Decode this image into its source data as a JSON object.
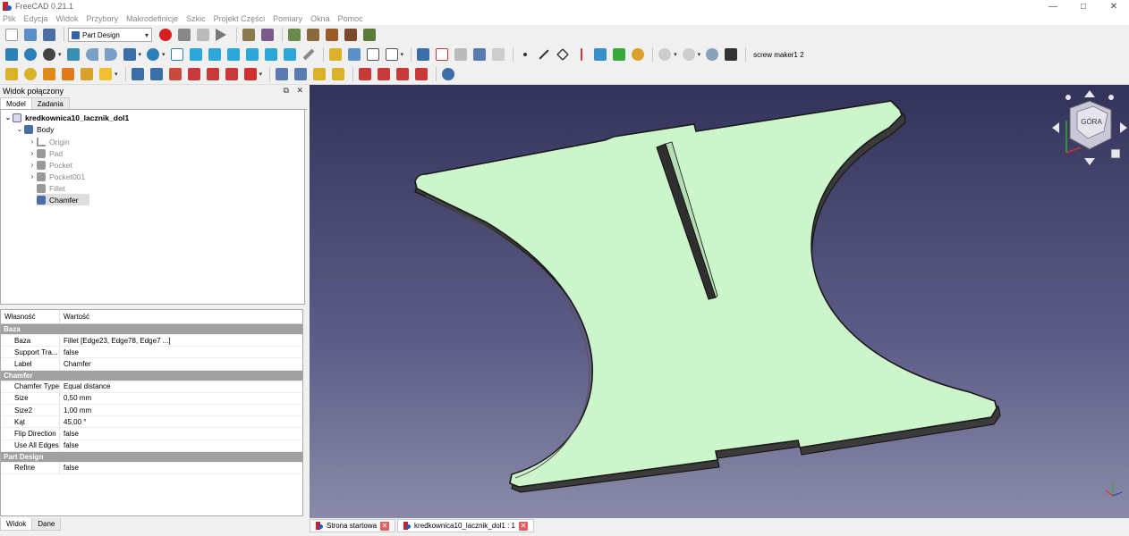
{
  "window": {
    "title": "FreeCAD 0.21.1",
    "minimize": "—",
    "maximize": "□",
    "close": "✕"
  },
  "menu": [
    "Plik",
    "Edycja",
    "Widok",
    "Przybory",
    "Makrodefinicje",
    "Szkic",
    "Projekt Części",
    "Pomiary",
    "Okna",
    "Pomoc"
  ],
  "toolbar": {
    "workbench": "Part Design",
    "macro_label": "screw maker1 2"
  },
  "combo": {
    "title": "Widok połączony",
    "tab_model": "Model",
    "tab_tasks": "Zadania",
    "bottom_tab_view": "Widok",
    "bottom_tab_data": "Dane"
  },
  "tree": {
    "document": "kredkownica10_lacznik_dol1",
    "body": "Body",
    "items": [
      "Origin",
      "Pad",
      "Pocket",
      "Pocket001",
      "Fillet",
      "Chamfer"
    ]
  },
  "properties": {
    "col_property": "Własność",
    "col_value": "Wartość",
    "group_base": "Baza",
    "base": [
      {
        "key": "Baza",
        "value": "Fillet [Edge23, Edge78, Edge7 ...]"
      },
      {
        "key": "Support Tra...",
        "value": "false"
      },
      {
        "key": "Label",
        "value": "Chamfer"
      }
    ],
    "group_chamfer": "Chamfer",
    "chamfer": [
      {
        "key": "Chamfer Type",
        "value": "Equal distance"
      },
      {
        "key": "Size",
        "value": "0,50 mm"
      },
      {
        "key": "Size2",
        "value": "1,00 mm"
      },
      {
        "key": "Kąt",
        "value": "45,00 °"
      },
      {
        "key": "Flip Direction",
        "value": "false"
      },
      {
        "key": "Use All Edges",
        "value": "false"
      }
    ],
    "group_partdesign": "Part Design",
    "partdesign": [
      {
        "key": "Refine",
        "value": "false"
      }
    ]
  },
  "navcube": {
    "face": "GÓRA"
  },
  "doc_tabs": [
    {
      "label": "Strona startowa"
    },
    {
      "label": "kredkownica10_lacznik_dol1 : 1"
    }
  ],
  "colors": {
    "part_face": "#cdf5cb",
    "part_edge": "#1a1a1a",
    "bg_top": "#33335a",
    "bg_bottom": "#8a8aa8"
  }
}
